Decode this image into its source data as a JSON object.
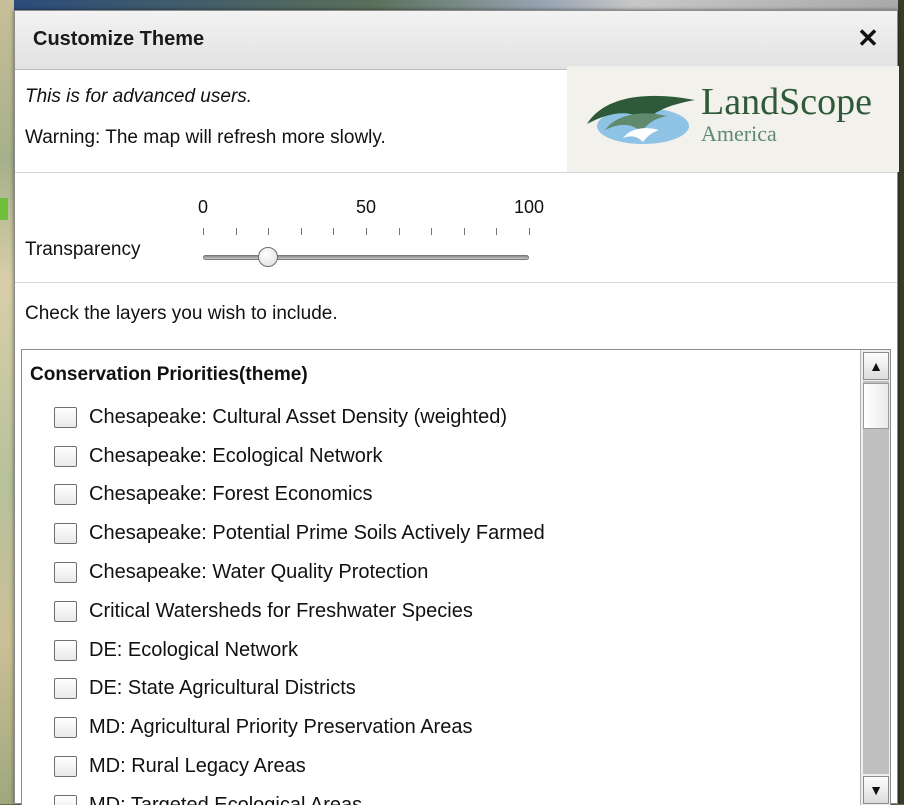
{
  "dialog": {
    "title": "Customize Theme",
    "close_label": "✕"
  },
  "intro": {
    "advanced": "This is for advanced users.",
    "warning": "Warning: The map will refresh more slowly."
  },
  "logo": {
    "main": "LandScope",
    "sub": "America"
  },
  "transparency": {
    "label": "Transparency",
    "ticks": [
      "0",
      "50",
      "100"
    ],
    "value": 20
  },
  "layers": {
    "prompt": "Check the layers you wish to include.",
    "group_title": "Conservation Priorities(theme)",
    "items": [
      {
        "label": "Chesapeake: Cultural Asset Density (weighted)",
        "checked": false
      },
      {
        "label": "Chesapeake: Ecological Network",
        "checked": false
      },
      {
        "label": "Chesapeake: Forest Economics",
        "checked": false
      },
      {
        "label": "Chesapeake: Potential Prime Soils Actively Farmed",
        "checked": false
      },
      {
        "label": "Chesapeake: Water Quality Protection",
        "checked": false
      },
      {
        "label": "Critical Watersheds for Freshwater Species",
        "checked": false
      },
      {
        "label": "DE: Ecological Network",
        "checked": false
      },
      {
        "label": "DE: State Agricultural Districts",
        "checked": false
      },
      {
        "label": "MD: Agricultural Priority Preservation Areas",
        "checked": false
      },
      {
        "label": "MD: Rural Legacy Areas",
        "checked": false
      },
      {
        "label": "MD: Targeted Ecological Areas",
        "checked": false
      }
    ]
  },
  "scrollbar": {
    "up": "▲",
    "down": "▼"
  },
  "colors": {
    "logo_dark_green": "#2f5a3a",
    "logo_light_green": "#5f8a6e",
    "logo_blue": "#8ec3e6"
  }
}
